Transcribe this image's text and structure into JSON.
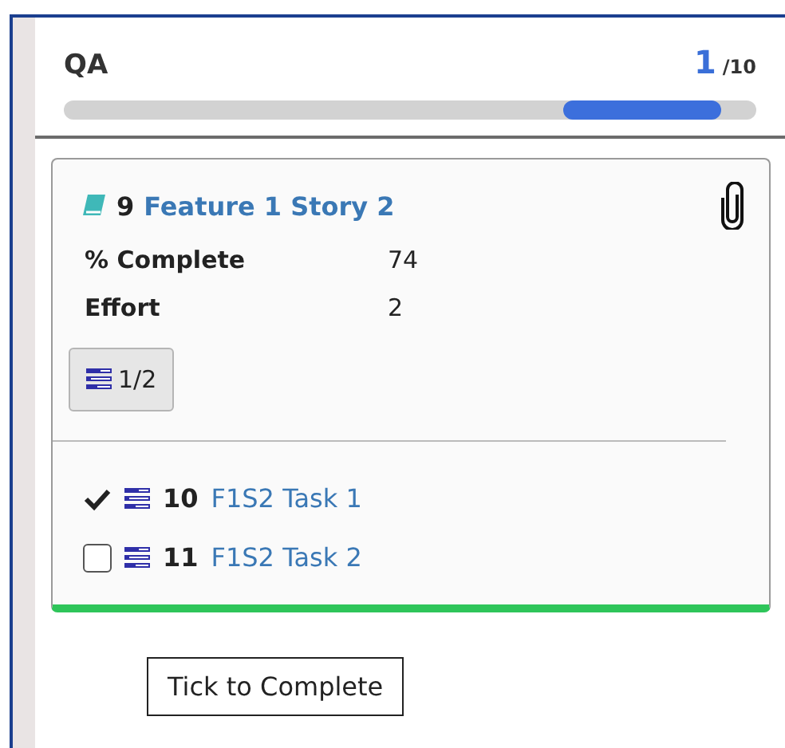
{
  "column": {
    "title": "QA",
    "count": "1",
    "total": "/10"
  },
  "card": {
    "number": "9",
    "title": "Feature 1 Story 2",
    "attachment": true,
    "fields": [
      {
        "label": "% Complete",
        "value": "74"
      },
      {
        "label": "Effort",
        "value": "2"
      }
    ],
    "subtasks_button": "1/2",
    "tasks": [
      {
        "number": "10",
        "title": "F1S2 Task 1",
        "checked": true
      },
      {
        "number": "11",
        "title": "F1S2 Task 2",
        "checked": false
      }
    ]
  },
  "tooltip": "Tick to Complete"
}
